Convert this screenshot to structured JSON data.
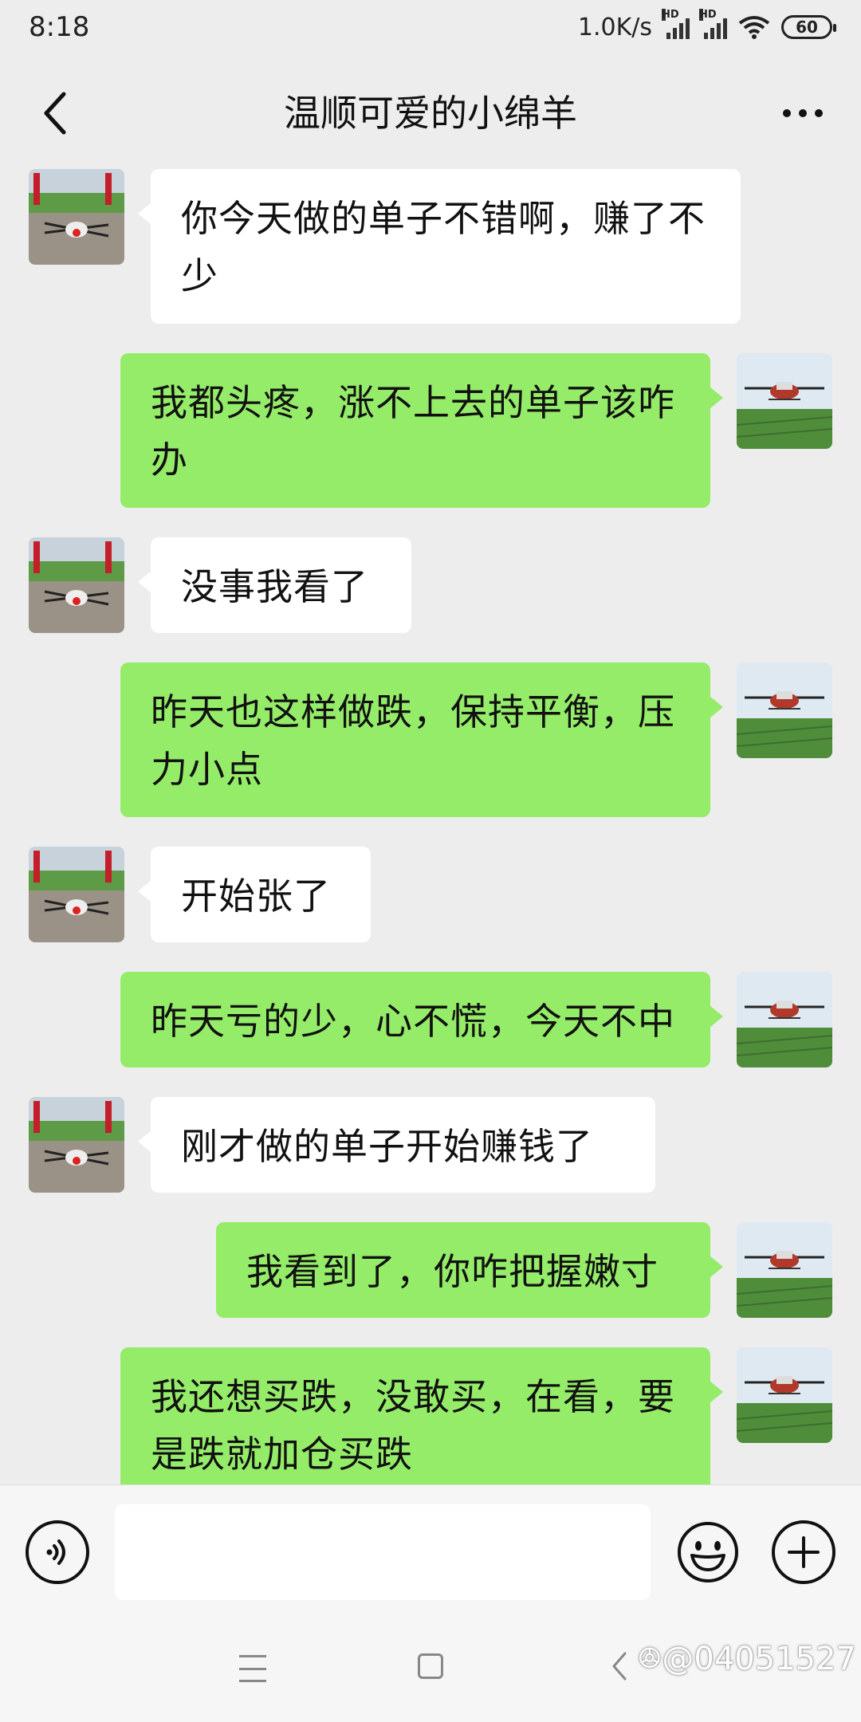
{
  "status_bar": {
    "time": "8:18",
    "network_speed": "1.0K/s",
    "signal_label": "HD",
    "battery": "60"
  },
  "header": {
    "title": "温顺可爱的小绵羊"
  },
  "messages": [
    {
      "side": "in",
      "text": "你今天做的单子不错啊，赚了不少"
    },
    {
      "side": "out",
      "text": "我都头疼，涨不上去的单子该咋办"
    },
    {
      "side": "in",
      "text": "没事我看了"
    },
    {
      "side": "out",
      "text": "昨天也这样做跌，保持平衡，压力小点"
    },
    {
      "side": "in",
      "text": "开始张了"
    },
    {
      "side": "out",
      "text": "昨天亏的少，心不慌，今天不中"
    },
    {
      "side": "in",
      "text": "刚才做的单子开始赚钱了"
    },
    {
      "side": "out",
      "text": "我看到了，你咋把握嫩寸"
    },
    {
      "side": "out",
      "text": "我还想买跌，没敢买，在看，要是跌就加仓买跌"
    }
  ],
  "input_bar": {
    "value": "",
    "placeholder": ""
  },
  "watermark": "@04051527",
  "colors": {
    "outgoing_bubble": "#95ec69",
    "incoming_bubble": "#ffffff",
    "background": "#ededed"
  },
  "icons": {
    "back": "chevron-left-icon",
    "more": "more-dots-icon",
    "voice": "voice-icon",
    "emoji": "emoji-icon",
    "plus": "plus-icon"
  }
}
